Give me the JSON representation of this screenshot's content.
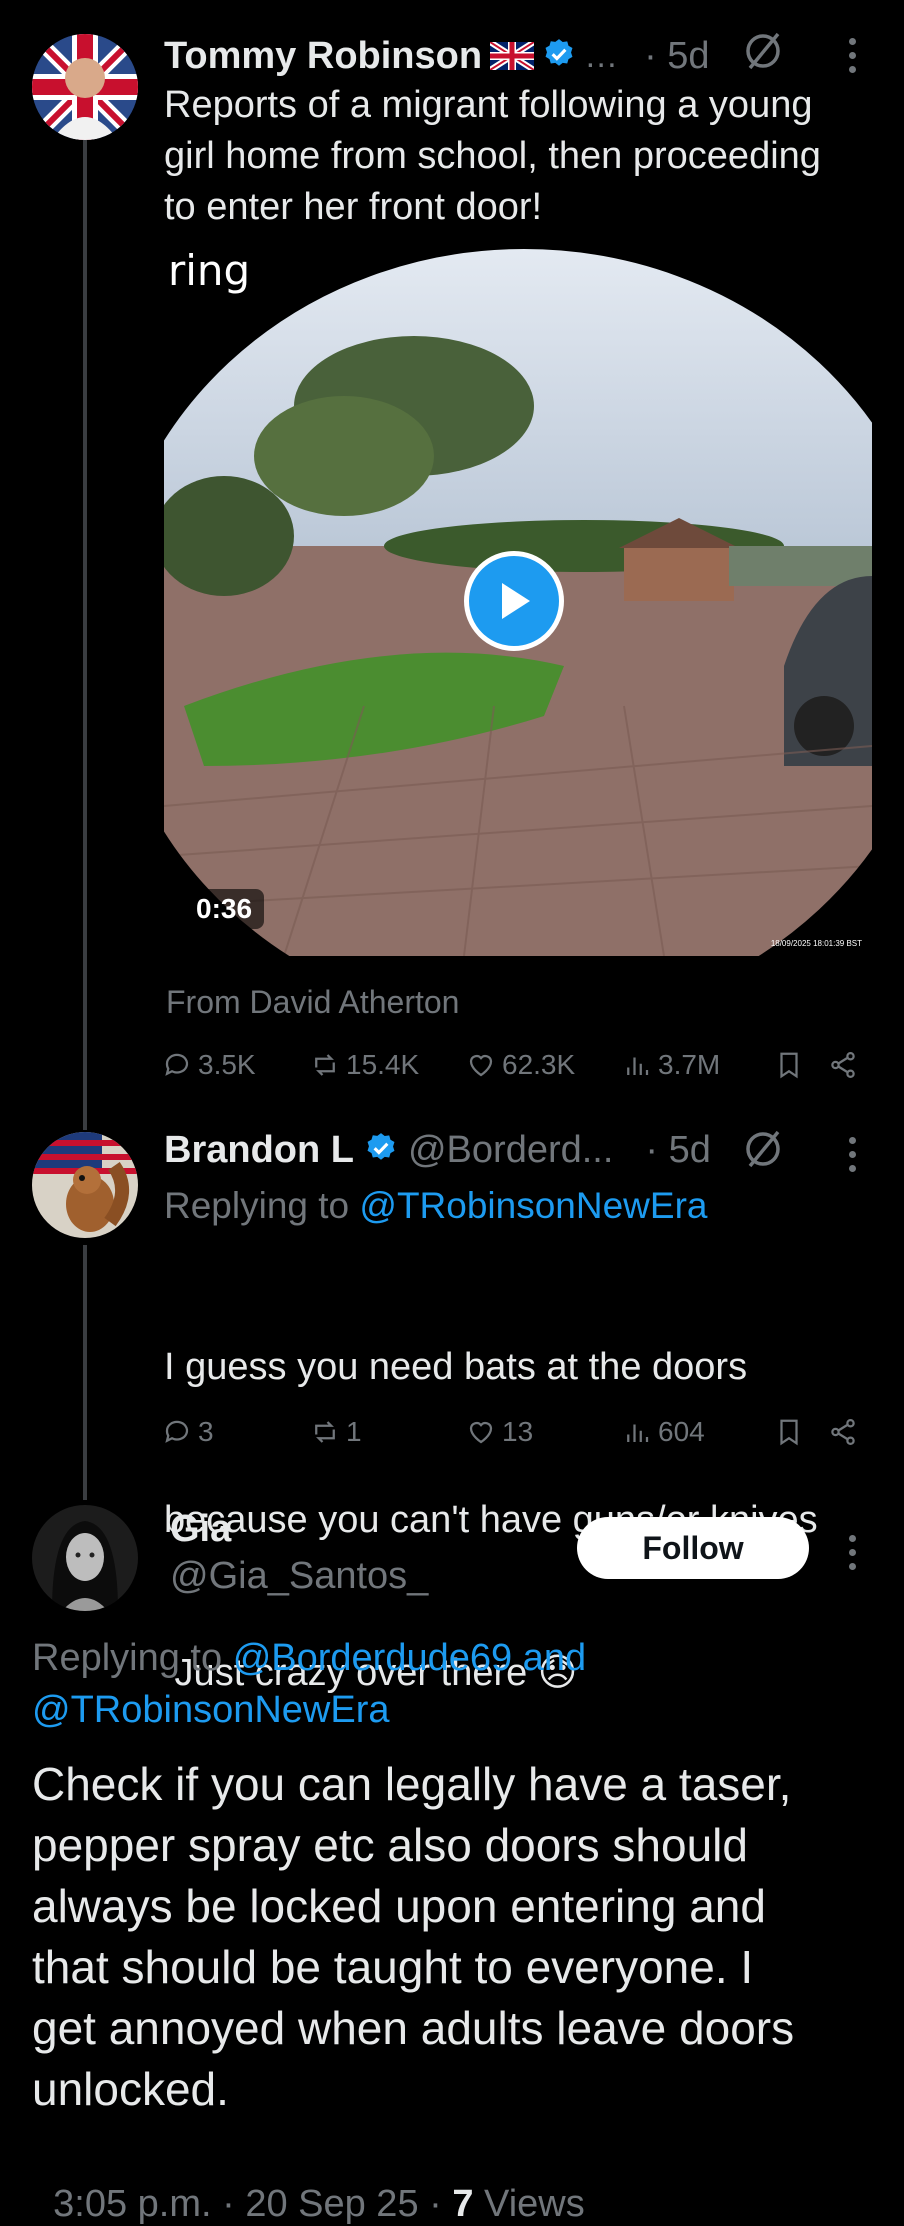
{
  "post1": {
    "name": "Tommy Robinson",
    "ellipsis": "…",
    "time": "· 5d",
    "text_lines": [
      "Reports of a migrant following a young",
      "girl home from school, then proceeding",
      "to enter her front door!"
    ],
    "video": {
      "logo": "ring",
      "duration": "0:36",
      "timestamp": "18/09/2025 18:01:39 BST"
    },
    "source": "From David Atherton",
    "metrics": {
      "replies": "3.5K",
      "reposts": "15.4K",
      "likes": "62.3K",
      "views": "3.7M"
    }
  },
  "post2": {
    "name": "Brandon L",
    "handle": "@Borderd...",
    "time": "· 5d",
    "replying_prefix": "Replying to",
    "replying_handle": "@TRobinsonNewEra",
    "text_lines": [
      "I guess you need bats at the doors",
      "because you can't have guns/or knives",
      " Just crazy over there 😞"
    ],
    "metrics": {
      "replies": "3",
      "reposts": "1",
      "likes": "13",
      "views": "604"
    }
  },
  "post3": {
    "name": "Gia",
    "handle": "@Gia_Santos_",
    "follow_label": "Follow",
    "replying_prefix": "Replying to",
    "replying_handles": "@Borderdude69 and",
    "replying_handles2": "@TRobinsonNewEra",
    "text_lines": [
      "Check if you can legally have a taser,",
      "pepper spray etc also doors should",
      "always be locked upon entering and",
      "that should be taught to everyone. I",
      "get annoyed when adults leave doors",
      "unlocked."
    ],
    "time": "3:05 p.m. · 20 Sep 25 · ",
    "views_count": "7",
    "views_label": " Views"
  },
  "colors": {
    "accent": "#1d9bf0",
    "muted": "#71767b",
    "text": "#e7e9ea",
    "background": "#000000"
  },
  "icons": [
    "grok-icon",
    "more-icon",
    "reply-icon",
    "repost-icon",
    "like-icon",
    "views-icon",
    "bookmark-icon",
    "share-icon",
    "play-icon",
    "verified-icon",
    "uk-flag-icon"
  ]
}
